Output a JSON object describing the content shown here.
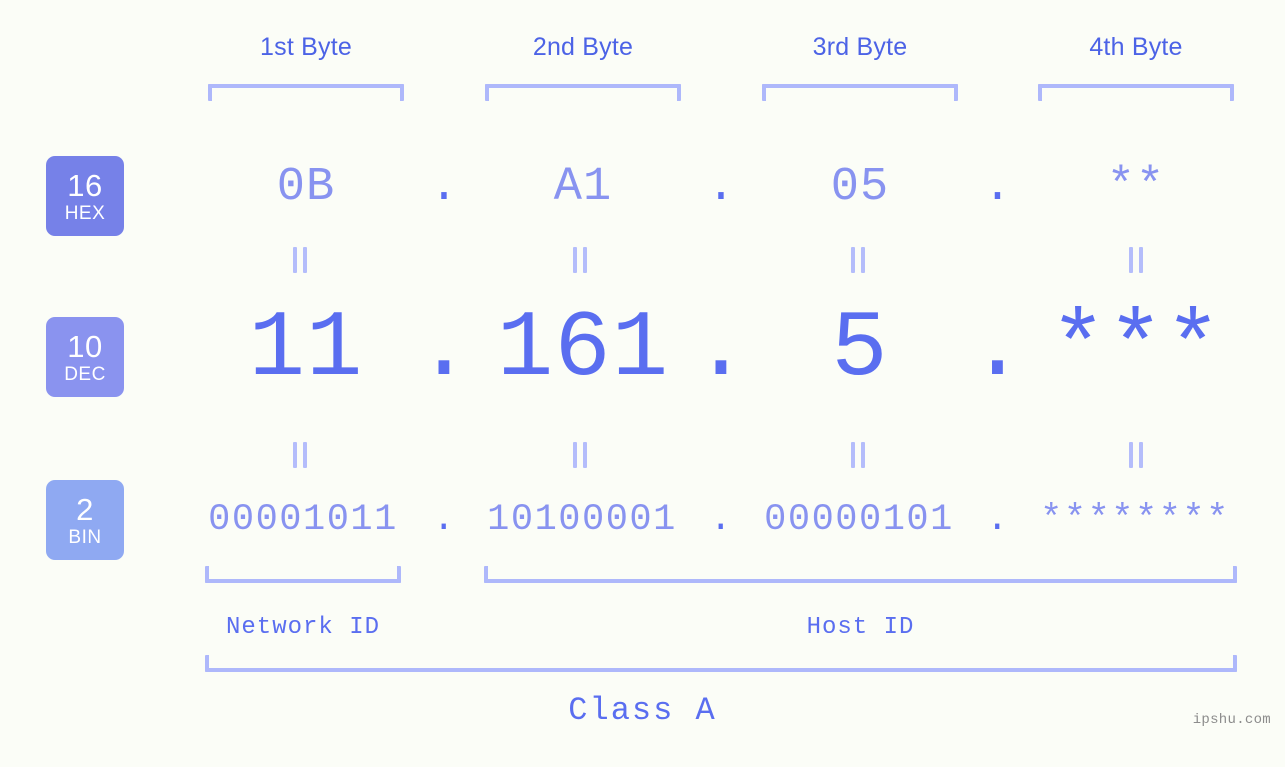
{
  "meta": {
    "background": "#fbfdf7",
    "accent_strong": "#5a6ef0",
    "accent_mid": "#8893f0",
    "accent_light": "#aeb8fb",
    "header_color": "#4c63e6"
  },
  "byte_headers": [
    {
      "label": "1st Byte"
    },
    {
      "label": "2nd Byte"
    },
    {
      "label": "3rd Byte"
    },
    {
      "label": "4th Byte"
    }
  ],
  "radix_badges": [
    {
      "num": "16",
      "system": "HEX",
      "color": "#7681e8"
    },
    {
      "num": "10",
      "system": "DEC",
      "color": "#8a93ef"
    },
    {
      "num": "2",
      "system": "BIN",
      "color": "#8fa9f2"
    }
  ],
  "rows": {
    "hex": {
      "values": [
        "0B",
        "A1",
        "05",
        "**"
      ],
      "separator": "."
    },
    "dec": {
      "values": [
        "11",
        "161",
        "5",
        "***"
      ],
      "separator": "."
    },
    "bin": {
      "values": [
        "00001011",
        "10100001",
        "00000101",
        "********"
      ],
      "separator": "."
    }
  },
  "separator_symbol": "‖",
  "id_labels": {
    "network": "Network ID",
    "host": "Host ID"
  },
  "class_label": "Class A",
  "watermark": "ipshu.com"
}
